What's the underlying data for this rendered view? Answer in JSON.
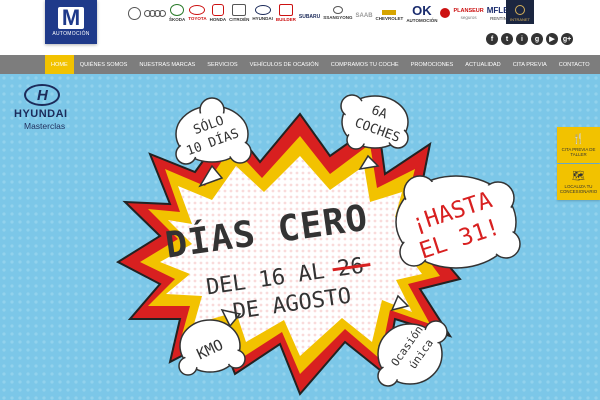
{
  "header": {
    "logo_letter": "M",
    "logo_sub": "AUTOMOCIÓN",
    "brands": [
      {
        "name": "VOLKSWAGEN",
        "label": ""
      },
      {
        "name": "AUDI",
        "label": ""
      },
      {
        "name": "ŠKODA",
        "label": "ŠKODA"
      },
      {
        "name": "TOYOTA",
        "label": "TOYOTA"
      },
      {
        "name": "HONDA",
        "label": "HONDA"
      },
      {
        "name": "CITROËN",
        "label": "CITROËN"
      },
      {
        "name": "HYUNDAI",
        "label": "HYUNDAI"
      },
      {
        "name": "BUILDER",
        "label": "BUILDER"
      },
      {
        "name": "SUBARU",
        "label": "SUBARU"
      },
      {
        "name": "SSANGYONG",
        "label": "SSANGYONG"
      },
      {
        "name": "SAAB",
        "label": "SAAB"
      },
      {
        "name": "CHEVROLET",
        "label": "CHEVROLET"
      }
    ],
    "ok_text": "OK",
    "ok_sub": "AUTOMOCIÓN",
    "planseur_text": "PLANSEUR",
    "planseur_sub": "seguros",
    "mflex_text": "MFLEX",
    "mflex_sub": "RENTING",
    "special_text": "INTRANET",
    "social": [
      "f",
      "t",
      "i",
      "g",
      "▶",
      "g+"
    ]
  },
  "nav": {
    "items": [
      "HOME",
      "QUIÉNES SOMOS",
      "NUESTRAS MARCAS",
      "SERVICIOS",
      "VEHÍCULOS DE OCASIÓN",
      "COMPRAMOS TU COCHE",
      "PROMOCIONES",
      "ACTUALIDAD",
      "CITA PREVIA",
      "CONTACTO"
    ],
    "active": "HOME"
  },
  "banner": {
    "hyundai_brand": "HYUNDAI",
    "hyundai_dealer": "Masterclas",
    "headline": "DÍAS CERO",
    "dates_prefix": "DEL 16 AL",
    "dates_struck": "26",
    "dates_month": "DE AGOSTO",
    "bubble_top_left_1": "SÓLO",
    "bubble_top_left_2": "10 DÍAS",
    "bubble_top_right_1": "6A",
    "bubble_top_right_2": "COCHES",
    "bubble_right_1": "¡HASTA",
    "bubble_right_2": "EL 31!",
    "bubble_bottom_left": "KMO",
    "bubble_bottom_right_1": "Ocasión",
    "bubble_bottom_right_2": "única"
  },
  "side_buttons": [
    {
      "icon": "🍴",
      "icon_name": "utensils-icon",
      "label": "CITA PREVIA DE TALLER"
    },
    {
      "icon": "🗺",
      "icon_name": "map-icon",
      "label": "LOCALIZA TU CONCESIONARIO"
    }
  ]
}
